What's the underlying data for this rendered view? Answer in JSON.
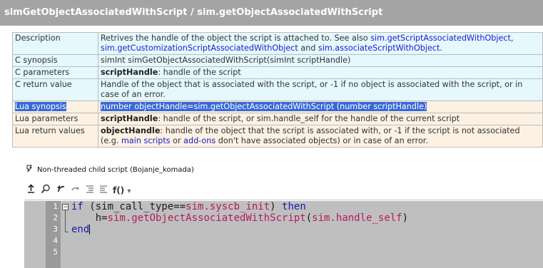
{
  "title": "simGetObjectAssociatedWithScript / sim.getObjectAssociatedWithScript",
  "rows": {
    "description": {
      "label": "Description",
      "text1": "Retrives the handle of the object the script is attached to. See also ",
      "link1": "sim.getScriptAssociatedWithObject",
      "sep1": ",",
      "link2": "sim.getCustomizationScriptAssociatedWithObject",
      "and": " and ",
      "link3": "sim.associateScriptWithObject",
      "end": "."
    },
    "c_synopsis": {
      "label": "C synopsis",
      "text": "simInt simGetObjectAssociatedWithScript(simInt scriptHandle)"
    },
    "c_parameters": {
      "label": "C parameters",
      "bold": "scriptHandle",
      "text": ": handle of the script"
    },
    "c_return": {
      "label": "C return value",
      "text": "Handle of the object that is associated with the script, or -1 if no object is associated with the script, or in case of an error."
    },
    "lua_synopsis": {
      "label": "Lua synopsis",
      "text": "number objectHandle=sim.getObjectAssociatedWithScript (number scriptHandle)"
    },
    "lua_parameters": {
      "label": "Lua parameters",
      "bold": "scriptHandle",
      "text": ": handle of the script, or sim.handle_self for the handle of the current script"
    },
    "lua_return": {
      "label": "Lua return values",
      "bold": "objectHandle",
      "text1": ": handle of the object that the script is associated with, or -1 if the script is not associated (e.g. ",
      "link1": "main scripts",
      "or": " or ",
      "link2": "add-ons",
      "text2": " don't have associated objects) or in case of an error."
    }
  },
  "tree_item": {
    "icon": "script-icon",
    "label": "Non-threaded child script (Bojanje_komada)"
  },
  "toolbar": {
    "icons": [
      "upload-icon",
      "search-icon",
      "undo-icon",
      "redo-icon",
      "indent-icon",
      "outdent-icon"
    ],
    "functions_label": "f()",
    "functions_arrow": "▾"
  },
  "editor": {
    "line_numbers": [
      "1",
      "2",
      "3",
      "4",
      "5"
    ],
    "line1": {
      "kw1": "if",
      "t1": " (sim_call_type==",
      "api": "sim.syscb_init",
      "t2": ") ",
      "kw2": "then"
    },
    "line2": {
      "indent": "    ",
      "t1": "h=",
      "api": "sim.getObjectAssociatedWithScript",
      "t2": "(",
      "api2": "sim.handle_self",
      "t3": ")"
    },
    "line3": {
      "kw": "end"
    }
  }
}
